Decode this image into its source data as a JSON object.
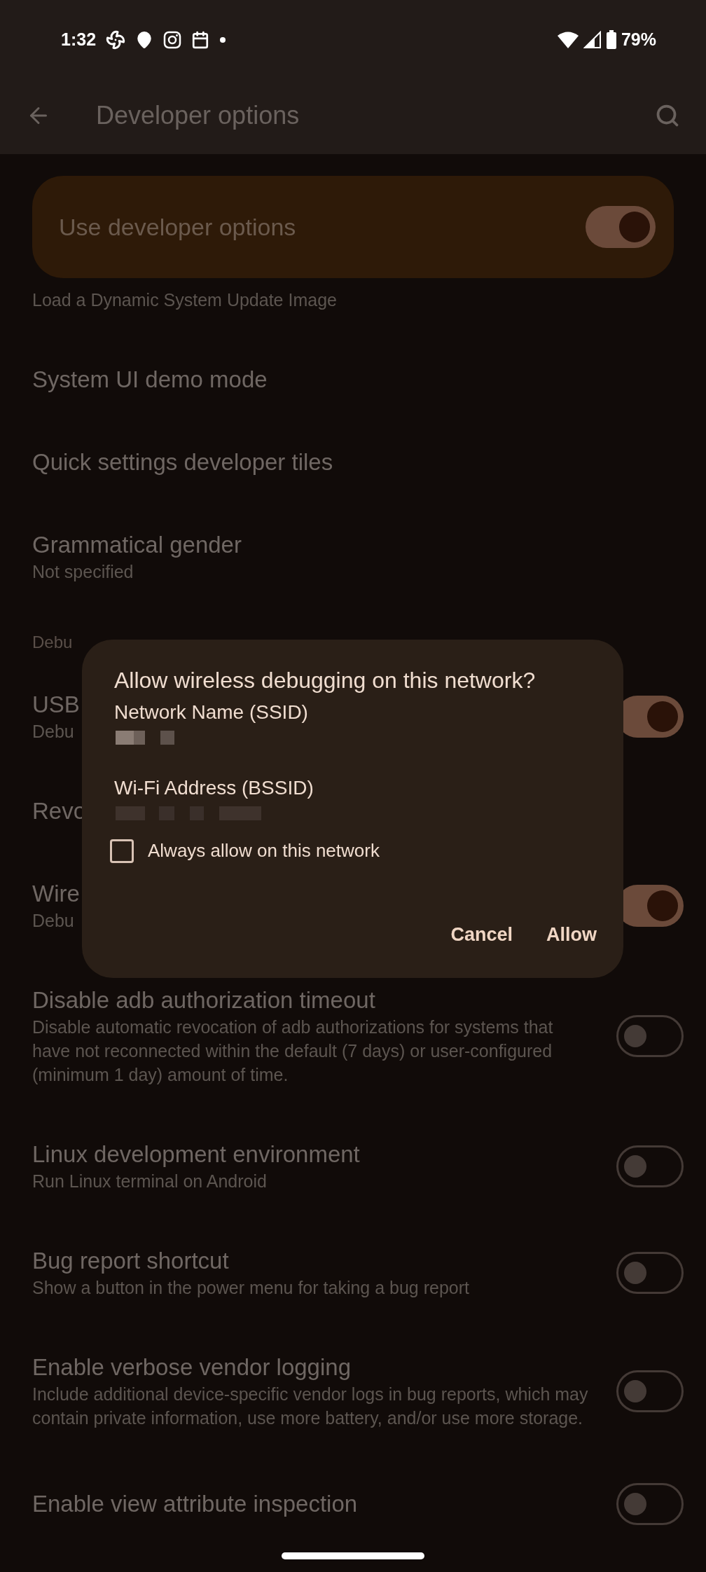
{
  "status_bar": {
    "time": "1:32",
    "battery": "79%"
  },
  "app_bar": {
    "title": "Developer options"
  },
  "master_switch": {
    "label": "Use developer options",
    "on": true
  },
  "settings": [
    {
      "kind": "item",
      "subtitle": "Load a Dynamic System Update Image"
    },
    {
      "kind": "item",
      "title": "System UI demo mode"
    },
    {
      "kind": "item",
      "title": "Quick settings developer tiles"
    },
    {
      "kind": "item",
      "title": "Grammatical gender",
      "subtitle": "Not specified"
    },
    {
      "kind": "header",
      "title": "Debu"
    },
    {
      "kind": "switch",
      "title": "USB",
      "subtitle": "Debu",
      "on": true
    },
    {
      "kind": "item",
      "title": "Revo"
    },
    {
      "kind": "switch",
      "title": "Wire",
      "subtitle": "Debu",
      "on": true
    },
    {
      "kind": "switch",
      "title": "Disable adb authorization timeout",
      "subtitle": "Disable automatic revocation of adb authorizations for systems that have not reconnected within the default (7 days) or user-configured (minimum 1 day) amount of time.",
      "on": false
    },
    {
      "kind": "switch",
      "title": "Linux development environment",
      "subtitle": "Run Linux terminal on Android",
      "on": false
    },
    {
      "kind": "switch",
      "title": "Bug report shortcut",
      "subtitle": "Show a button in the power menu for taking a bug report",
      "on": false
    },
    {
      "kind": "switch",
      "title": "Enable verbose vendor logging",
      "subtitle": "Include additional device-specific vendor logs in bug reports, which may contain private information, use more battery, and/or use more storage.",
      "on": false
    },
    {
      "kind": "switch",
      "title": "Enable view attribute inspection",
      "on": false
    }
  ],
  "dialog": {
    "title": "Allow wireless debugging on this network?",
    "field_labels": [
      "Network Name (SSID)",
      "Wi-Fi Address (BSSID)"
    ],
    "checkbox": {
      "label": "Always allow on this network",
      "checked": false
    },
    "buttons": [
      "Cancel",
      "Allow"
    ]
  }
}
